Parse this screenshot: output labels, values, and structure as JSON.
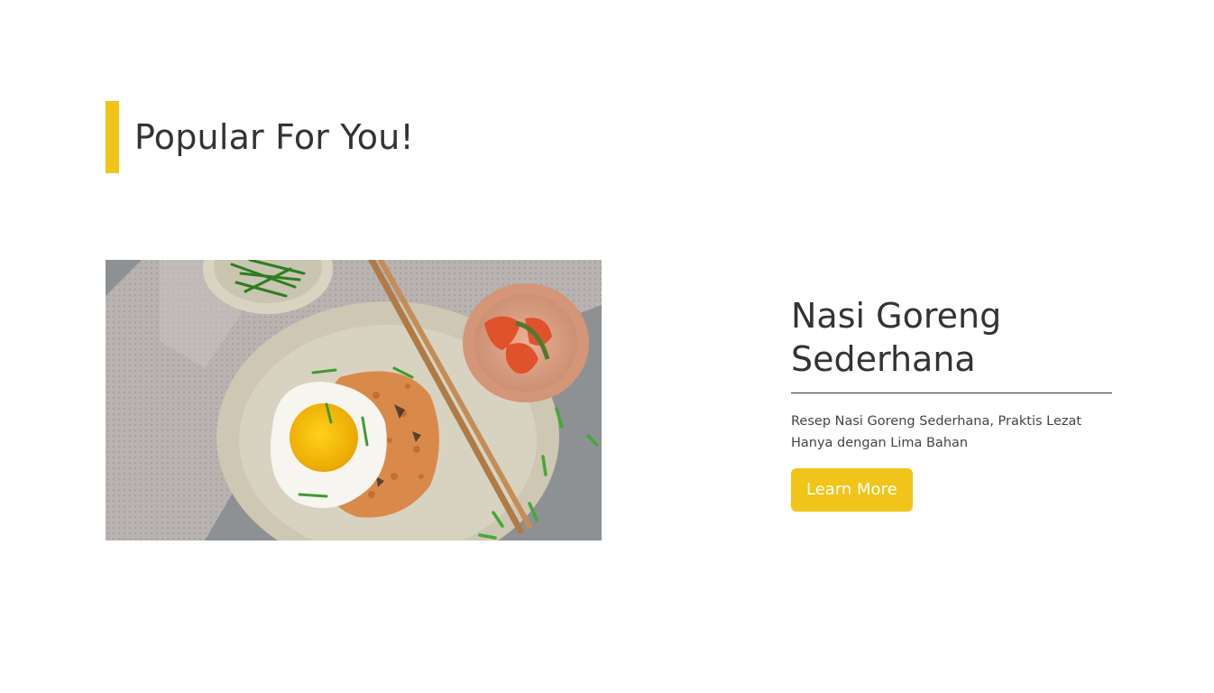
{
  "section": {
    "title": "Popular For You!",
    "accent_color": "#f0c419"
  },
  "featured": {
    "image_alt": "Nasi Goreng Sederhana",
    "title": "Nasi Goreng Sederhana",
    "description": "Resep Nasi Goreng Sederhana, Praktis Lezat Hanya dengan Lima Bahan",
    "button_label": "Learn More",
    "button_color": "#f0c419"
  }
}
